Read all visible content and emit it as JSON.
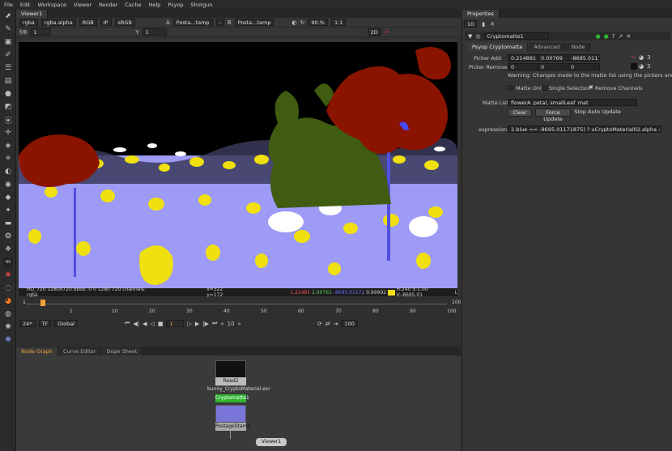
{
  "menu": [
    "File",
    "Edit",
    "Workspace",
    "Viewer",
    "Render",
    "Cache",
    "Help",
    "Psyop",
    "Shotgun"
  ],
  "viewer": {
    "tab": "Viewer1",
    "channels": "rgba",
    "alpha": "rgba.alpha",
    "colorspace": "RGB",
    "ip": "IP",
    "lut": "sRGB",
    "input_a_label": "A",
    "input_a": "Posta...tamp",
    "dash": "-",
    "input_b_label": "B",
    "input_b": "Posta...tamp",
    "zoom": "90.%",
    "ratio": "1:1",
    "fstop": "f/8",
    "frame_field": "1",
    "y_label": "Y",
    "y_value": "1",
    "view_mode": "2D"
  },
  "info_bar": {
    "format": "HD_720 1280x720  bbox: 0 0 1280 720 channels: rgba",
    "coords": "x=322 y=172",
    "r": "1.21481",
    "g": "1.00761",
    "b": "-8695.01172",
    "a": "0.99992",
    "hsv": "H:240 S:1.00 V:-8695.01",
    "mode": "L"
  },
  "timeline": {
    "ticks": [
      "1",
      "10",
      "20",
      "30",
      "40",
      "50",
      "60",
      "70",
      "80",
      "90",
      "100"
    ],
    "start": "1",
    "end": "100",
    "end_right": "100",
    "fps": "24*",
    "tf": "TF",
    "global": "Global",
    "current_frame": "1",
    "step": "10"
  },
  "node_graph": {
    "tabs": [
      "Node Graph",
      "Curve Editor",
      "Dope Sheet"
    ],
    "nodes": {
      "read": "Read2",
      "read_sub": "bunny_CryptoMaterial.exr",
      "crypto": "Cryptomatte1",
      "postage": "PostageStamp",
      "viewer": "Viewer1"
    }
  },
  "properties": {
    "tab": "Properties",
    "max_panels": "10",
    "node_name": "Cryptomatte1",
    "tabs": [
      "Psyop Cryptomatte",
      "Advanced",
      "Node"
    ],
    "picker_add_label": "Picker Add",
    "picker_add": [
      "0.214891",
      "0.00769",
      "-8695.0117"
    ],
    "picker_remove_label": "Picker Remove",
    "picker_remove": [
      "0",
      "0",
      "0"
    ],
    "warning": "Warning: Changes made to the matte list using the pickers are not",
    "matte_only": "Matte Only",
    "single_selection": "Single Selection",
    "remove_channels": "Remove Channels",
    "matte_list_label": "Matte List",
    "matte_list": "flowerA_petal, smallLeaf_mat",
    "clear": "Clear",
    "force_update": "Force Update",
    "stop_auto_update": "Stop Auto Update",
    "expression_label": "expression",
    "expression": "2.blue == -8695.01171875) ? uCryptoMaterial02.alpha : 0.0) + 0",
    "picker_count": "3"
  },
  "colors": {
    "bg_panel": "#353535",
    "accent_green": "#2fb42f",
    "accent_orange": "#f2a13a",
    "canvas_blue": "#9d9bf6",
    "red_readout": "#ff5050",
    "green_readout": "#5fd65f",
    "blue_readout": "#6a6aff"
  }
}
